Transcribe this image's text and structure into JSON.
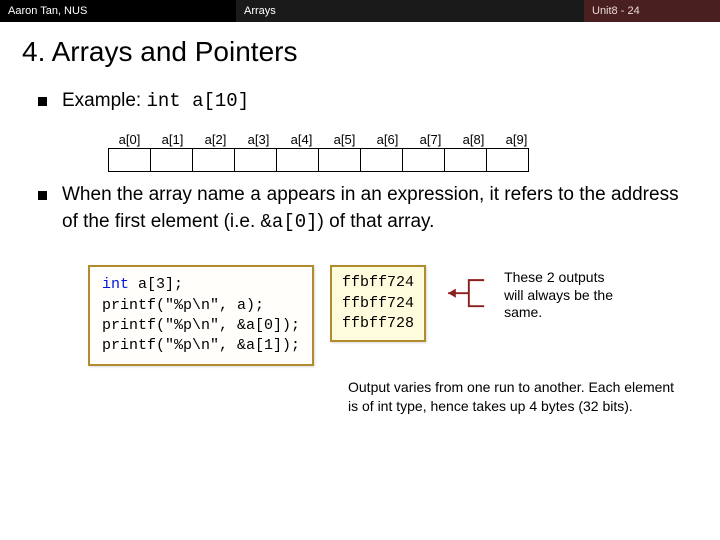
{
  "topbar": {
    "left": "Aaron Tan, NUS",
    "mid": "Arrays",
    "right": "Unit8 - 24"
  },
  "title": "4. Arrays and Pointers",
  "bullet1": {
    "lead": "Example: ",
    "code": "int a[10]"
  },
  "array": {
    "labels": [
      "a[0]",
      "a[1]",
      "a[2]",
      "a[3]",
      "a[4]",
      "a[5]",
      "a[6]",
      "a[7]",
      "a[8]",
      "a[9]"
    ]
  },
  "bullet2": {
    "p1": "When the array name ",
    "c1": "a",
    "p2": " appears in an expression, it refers to the address of the first element (i.e. ",
    "c2": "&a[0]",
    "p3": ") of that array."
  },
  "code": {
    "l1a": "int",
    "l1b": " a[3];",
    "l2": "printf(\"%p\\n\", a);",
    "l3": "printf(\"%p\\n\", &a[0]);",
    "l4": "printf(\"%p\\n\", &a[1]);"
  },
  "output": {
    "l1": "ffbff724",
    "l2": "ffbff724",
    "l3": "ffbff728"
  },
  "sidenote": "These 2 outputs will always be the same.",
  "footnote": "Output varies from one run to another. Each element is of int type, hence takes up 4 bytes (32 bits)."
}
